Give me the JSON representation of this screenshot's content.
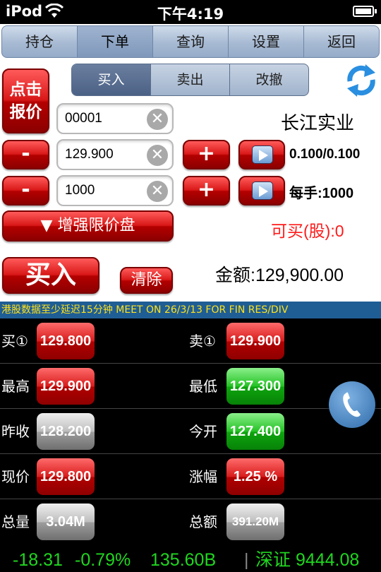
{
  "status_bar": {
    "carrier": "iPod",
    "time": "下午4:19"
  },
  "tabs": [
    {
      "label": "持仓",
      "active": false
    },
    {
      "label": "下单",
      "active": true
    },
    {
      "label": "查询",
      "active": false
    },
    {
      "label": "设置",
      "active": false
    },
    {
      "label": "返回",
      "active": false
    }
  ],
  "order_type": [
    {
      "label": "买入",
      "active": true
    },
    {
      "label": "卖出",
      "active": false
    },
    {
      "label": "改撤",
      "active": false
    }
  ],
  "quote_button": {
    "line1": "点击",
    "line2": "报价"
  },
  "form": {
    "stock_code": "00001",
    "stock_name": "长江实业",
    "price": "129.900",
    "spread": "0.100/0.100",
    "quantity": "1000",
    "lot_size": "每手:1000",
    "clear_symbol": "✕",
    "minus": "-",
    "plus": "+"
  },
  "enhance_button": "▼ 增强限价盘",
  "can_buy": "可买(股):0",
  "buy_button": "买入",
  "clear_button": "清除",
  "amount": "金额:129,900.00",
  "ticker_text": "港股数据至少延迟15分钟   MEET ON 26/3/13     FOR FIN RES/DIV",
  "quotes": [
    {
      "left_label": "买①",
      "left_value": "129.800",
      "left_color": "red",
      "right_label": "卖①",
      "right_value": "129.900",
      "right_color": "red"
    },
    {
      "left_label": "最高",
      "left_value": "129.900",
      "left_color": "red",
      "right_label": "最低",
      "right_value": "127.300",
      "right_color": "green"
    },
    {
      "left_label": "昨收",
      "left_value": "128.200",
      "left_color": "gray",
      "right_label": "今开",
      "right_value": "127.400",
      "right_color": "green"
    },
    {
      "left_label": "现价",
      "left_value": "129.800",
      "left_color": "red",
      "right_label": "涨幅",
      "right_value": "1.25 %",
      "right_color": "red"
    },
    {
      "left_label": "总量",
      "left_value": "3.04M",
      "left_color": "gray",
      "right_label": "总额",
      "right_value": "391.20M",
      "right_color": "gray"
    }
  ],
  "index_bar": {
    "change": "-18.31",
    "change_pct": "-0.79%",
    "turnover": "135.60B",
    "separator": "|",
    "index_name_value": "深证 9444.08"
  },
  "colors": {
    "accent_red": "#d91818",
    "green_text": "#20d620",
    "ticker_bg": "#1f5e95",
    "ticker_text": "#ffe21a"
  }
}
